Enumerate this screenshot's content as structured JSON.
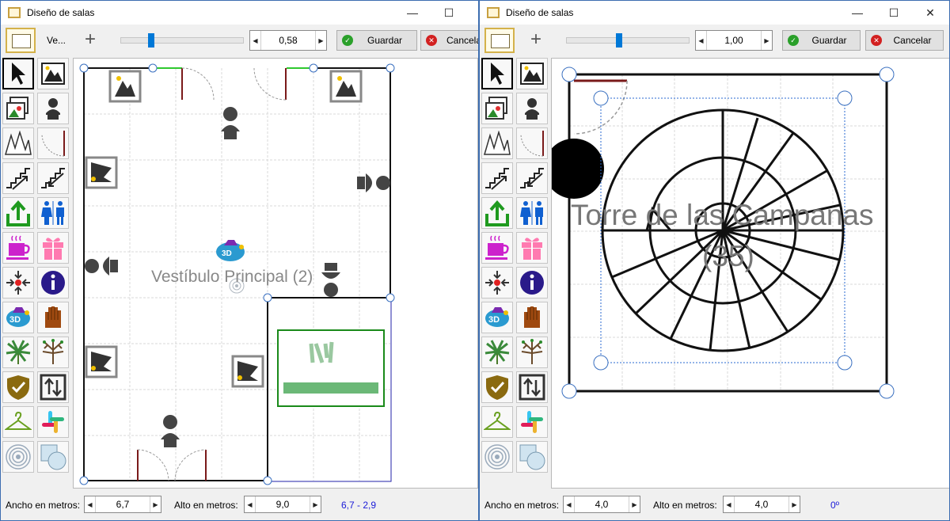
{
  "left": {
    "title": "Diseño de salas",
    "toolbar_label": "Ve...",
    "zoom_value": "0,58",
    "zoom_fraction": 0.23,
    "save_label": "Guardar",
    "cancel_label": "Cancela",
    "room_label": "Vestíbulo Principal (2)",
    "width_label": "Ancho en metros:",
    "width_value": "6,7",
    "height_label": "Alto en metros:",
    "height_value": "9,0",
    "coords": "6,7 - 2,9"
  },
  "right": {
    "title": "Diseño de salas",
    "zoom_value": "1,00",
    "zoom_fraction": 0.42,
    "save_label": "Guardar",
    "cancel_label": "Cancelar",
    "room_label_line1": "Torre de las Campanas",
    "room_label_line2": "(35)",
    "width_label": "Ancho en metros:",
    "width_value": "4,0",
    "height_label": "Alto en metros:",
    "height_value": "4,0",
    "rotation": "0º"
  },
  "tools": [
    "pointer-icon",
    "picture-icon",
    "pictures-icon",
    "bust-icon",
    "mountains-icon",
    "door-icon",
    "stairs-up-icon",
    "stairs-down-icon",
    "exit-icon",
    "restroom-icon",
    "cafe-icon",
    "gift-icon",
    "center-point-icon",
    "info-icon",
    "view-3d-icon",
    "hand-icon",
    "plant-icon",
    "tree-icon",
    "shield-icon",
    "elevator-icon",
    "coat-hanger-icon",
    "slack-icon",
    "wifi-icon",
    "shapes-icon"
  ],
  "colors": {
    "accent": "#0078d7",
    "save_green": "#2aa02a",
    "cancel_red": "#d22020",
    "coords_blue": "#1a1ad8"
  }
}
